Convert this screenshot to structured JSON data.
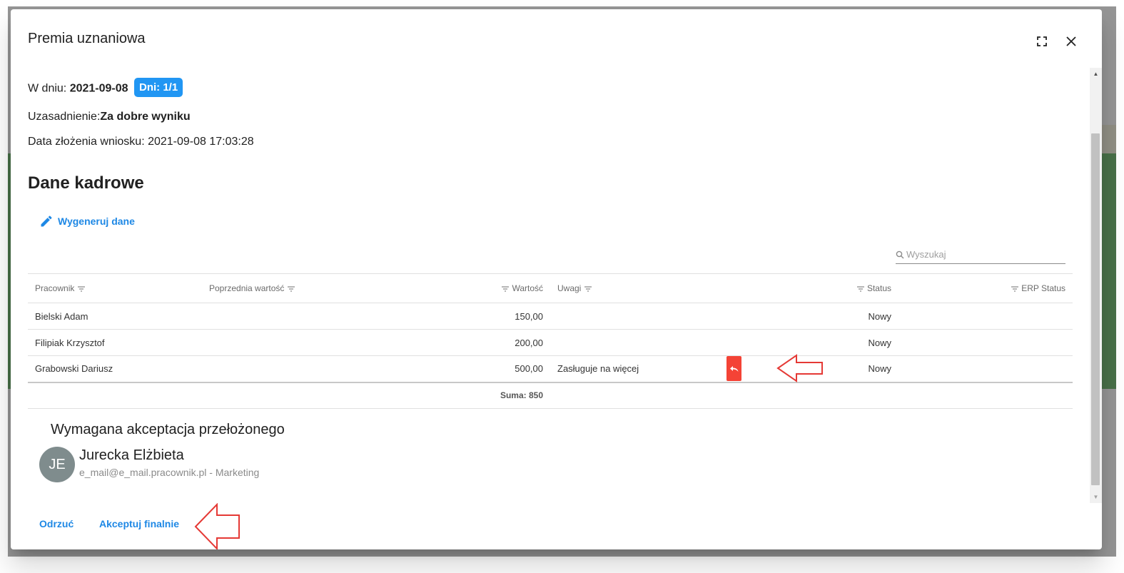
{
  "dialog": {
    "title": "Premia uznaniowa",
    "fullscreen_icon": "fullscreen-icon",
    "close_icon": "close-icon"
  },
  "details": {
    "date_label": "W dniu:",
    "date_value": "2021-09-08",
    "days_chip": "Dni: 1/1",
    "reason_label": "Uzasadnienie:",
    "reason_value": "Za dobre wyniku",
    "submitted": "Data złożenia wniosku: 2021-09-08 17:03:28"
  },
  "section": {
    "title": "Dane kadrowe",
    "generate_label": "Wygeneruj dane",
    "generate_icon": "pencil-icon"
  },
  "search": {
    "placeholder": "Wyszukaj",
    "icon": "search-icon"
  },
  "table": {
    "columns": {
      "employee": "Pracownik",
      "previous": "Poprzednia wartość",
      "value": "Wartość",
      "notes": "Uwagi",
      "status": "Status",
      "erp_status": "ERP Status"
    },
    "rows": [
      {
        "employee": "Bielski Adam",
        "previous": "",
        "value": "150,00",
        "notes": "",
        "status": "Nowy",
        "erp_status": ""
      },
      {
        "employee": "Filipiak Krzysztof",
        "previous": "",
        "value": "200,00",
        "notes": "",
        "status": "Nowy",
        "erp_status": ""
      },
      {
        "employee": "Grabowski Dariusz",
        "previous": "",
        "value": "500,00",
        "notes": "Zasługuje na więcej",
        "status": "Nowy",
        "erp_status": ""
      }
    ],
    "sum": "Suma: 850",
    "undo_icon": "undo-icon"
  },
  "approval": {
    "title": "Wymagana akceptacja przełożonego",
    "initials": "JE",
    "name": "Jurecka Elżbieta",
    "subtitle": "e_mail@e_mail.pracownik.pl - Marketing"
  },
  "actions": {
    "reject": "Odrzuć",
    "accept": "Akceptuj finalnie"
  },
  "colors": {
    "accent": "#1e88e5",
    "chip": "#2196f3",
    "danger": "#f44336",
    "annotation": "#e53935"
  }
}
